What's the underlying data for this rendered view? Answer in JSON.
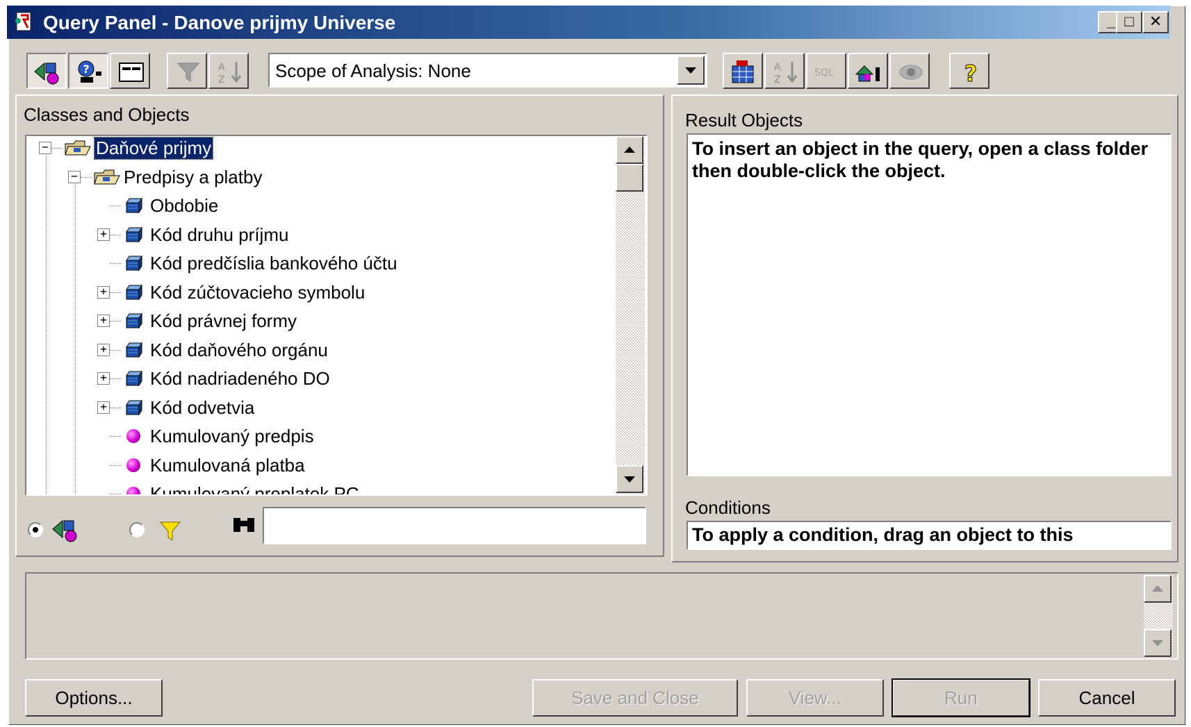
{
  "window": {
    "title": "Query Panel - Danove prijmy Universe",
    "controls": {
      "minimize": "_",
      "maximize": "□",
      "close": "✕"
    }
  },
  "toolbar": {
    "scope_dropdown_value": "Scope of Analysis: None",
    "left_buttons": [
      "classes-objects-view-icon",
      "predefined-conditions-icon",
      "panel-layout-icon",
      "filter-icon",
      "sort-icon"
    ],
    "right_buttons": [
      "table-view-icon",
      "sort-az-icon",
      "sql-icon",
      "data-provider-icon",
      "eye-icon",
      "help-icon"
    ]
  },
  "classes_panel": {
    "label": "Classes and Objects",
    "tree": [
      {
        "text": "Daňové prijmy",
        "type": "class",
        "level": 0,
        "expanded": true,
        "selected": true
      },
      {
        "text": "Predpisy a platby",
        "type": "class",
        "level": 1,
        "expanded": true
      },
      {
        "text": "Obdobie",
        "type": "dimension",
        "level": 2,
        "has_children": false
      },
      {
        "text": "Kód druhu príjmu",
        "type": "dimension",
        "level": 2,
        "has_children": true
      },
      {
        "text": "Kód predčíslia bankového účtu",
        "type": "dimension",
        "level": 2,
        "has_children": false
      },
      {
        "text": "Kód zúčtovacieho symbolu",
        "type": "dimension",
        "level": 2,
        "has_children": true
      },
      {
        "text": "Kód právnej formy",
        "type": "dimension",
        "level": 2,
        "has_children": true
      },
      {
        "text": "Kód daňového orgánu",
        "type": "dimension",
        "level": 2,
        "has_children": true
      },
      {
        "text": "Kód nadriadeného DO",
        "type": "dimension",
        "level": 2,
        "has_children": true
      },
      {
        "text": "Kód odvetvia",
        "type": "dimension",
        "level": 2,
        "has_children": true
      },
      {
        "text": "Kumulovaný predpis",
        "type": "measure",
        "level": 2,
        "has_children": false
      },
      {
        "text": "Kumulovaná platba",
        "type": "measure",
        "level": 2,
        "has_children": false
      },
      {
        "text": "Kumulovaný preplatok PC",
        "type": "measure",
        "level": 2,
        "has_children": false
      }
    ],
    "view_options": {
      "objects_selected": true,
      "conditions_selected": false
    },
    "search_value": ""
  },
  "result_panel": {
    "label": "Result Objects",
    "hint": "To insert an object in the query, open a class folder then double-click the object."
  },
  "conditions_panel": {
    "label": "Conditions",
    "hint": "To apply a condition, drag an object to this"
  },
  "buttons": {
    "options": "Options...",
    "save_and_close": "Save and Close",
    "view": "View...",
    "run": "Run",
    "cancel": "Cancel"
  },
  "colors": {
    "face": "#d4d0c8",
    "title_start": "#0a246a",
    "selection": "#0a246a"
  }
}
